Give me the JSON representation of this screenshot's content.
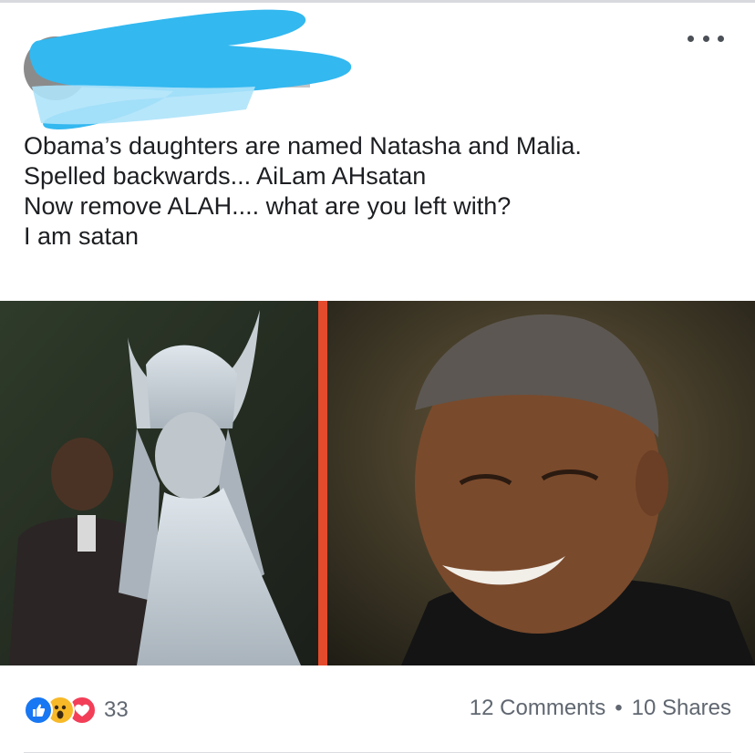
{
  "post": {
    "text_lines": [
      "Obama’s daughters are named Natasha and Malia.",
      "Spelled backwards... AiLam AHsatan",
      "Now remove ALAH.... what are you left with?",
      "I am satan"
    ],
    "more_icon": "more-horizontal-icon"
  },
  "footer": {
    "reaction_count": "33",
    "comments": "12 Comments",
    "shares": "10 Shares",
    "separator": "•",
    "reaction_icons": [
      "like-icon",
      "wow-icon",
      "love-icon"
    ]
  },
  "colors": {
    "redaction": "#33b8f0",
    "divider": "#e34b2c",
    "like": "#1877f2",
    "wow": "#f7b928",
    "love": "#f33e58"
  }
}
